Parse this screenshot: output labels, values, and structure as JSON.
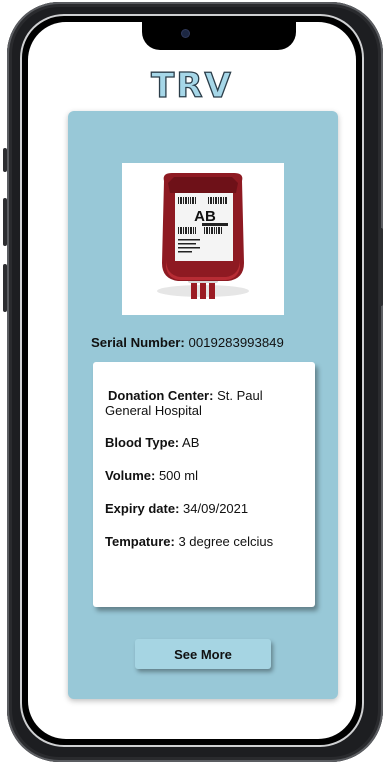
{
  "app": {
    "logo": "TRV"
  },
  "product": {
    "bag_label": "AB",
    "serial_label": "Serial Number:",
    "serial_value": "0019283993849"
  },
  "details": {
    "donation_center_label": "Donation Center:",
    "donation_center_value": "St. Paul General Hospital",
    "blood_type_label": "Blood Type:",
    "blood_type_value": "AB",
    "volume_label": "Volume:",
    "volume_value": "500 ml",
    "expiry_label": "Expiry date:",
    "expiry_value": "34/09/2021",
    "temperature_label": "Tempature:",
    "temperature_value": "3 degree celcius"
  },
  "actions": {
    "see_more_label": "See More"
  },
  "colors": {
    "card_bg": "#98c8d7",
    "button_bg": "#a6d5e3",
    "logo_fill": "#a6d7e8",
    "blood": "#8e1a22"
  }
}
